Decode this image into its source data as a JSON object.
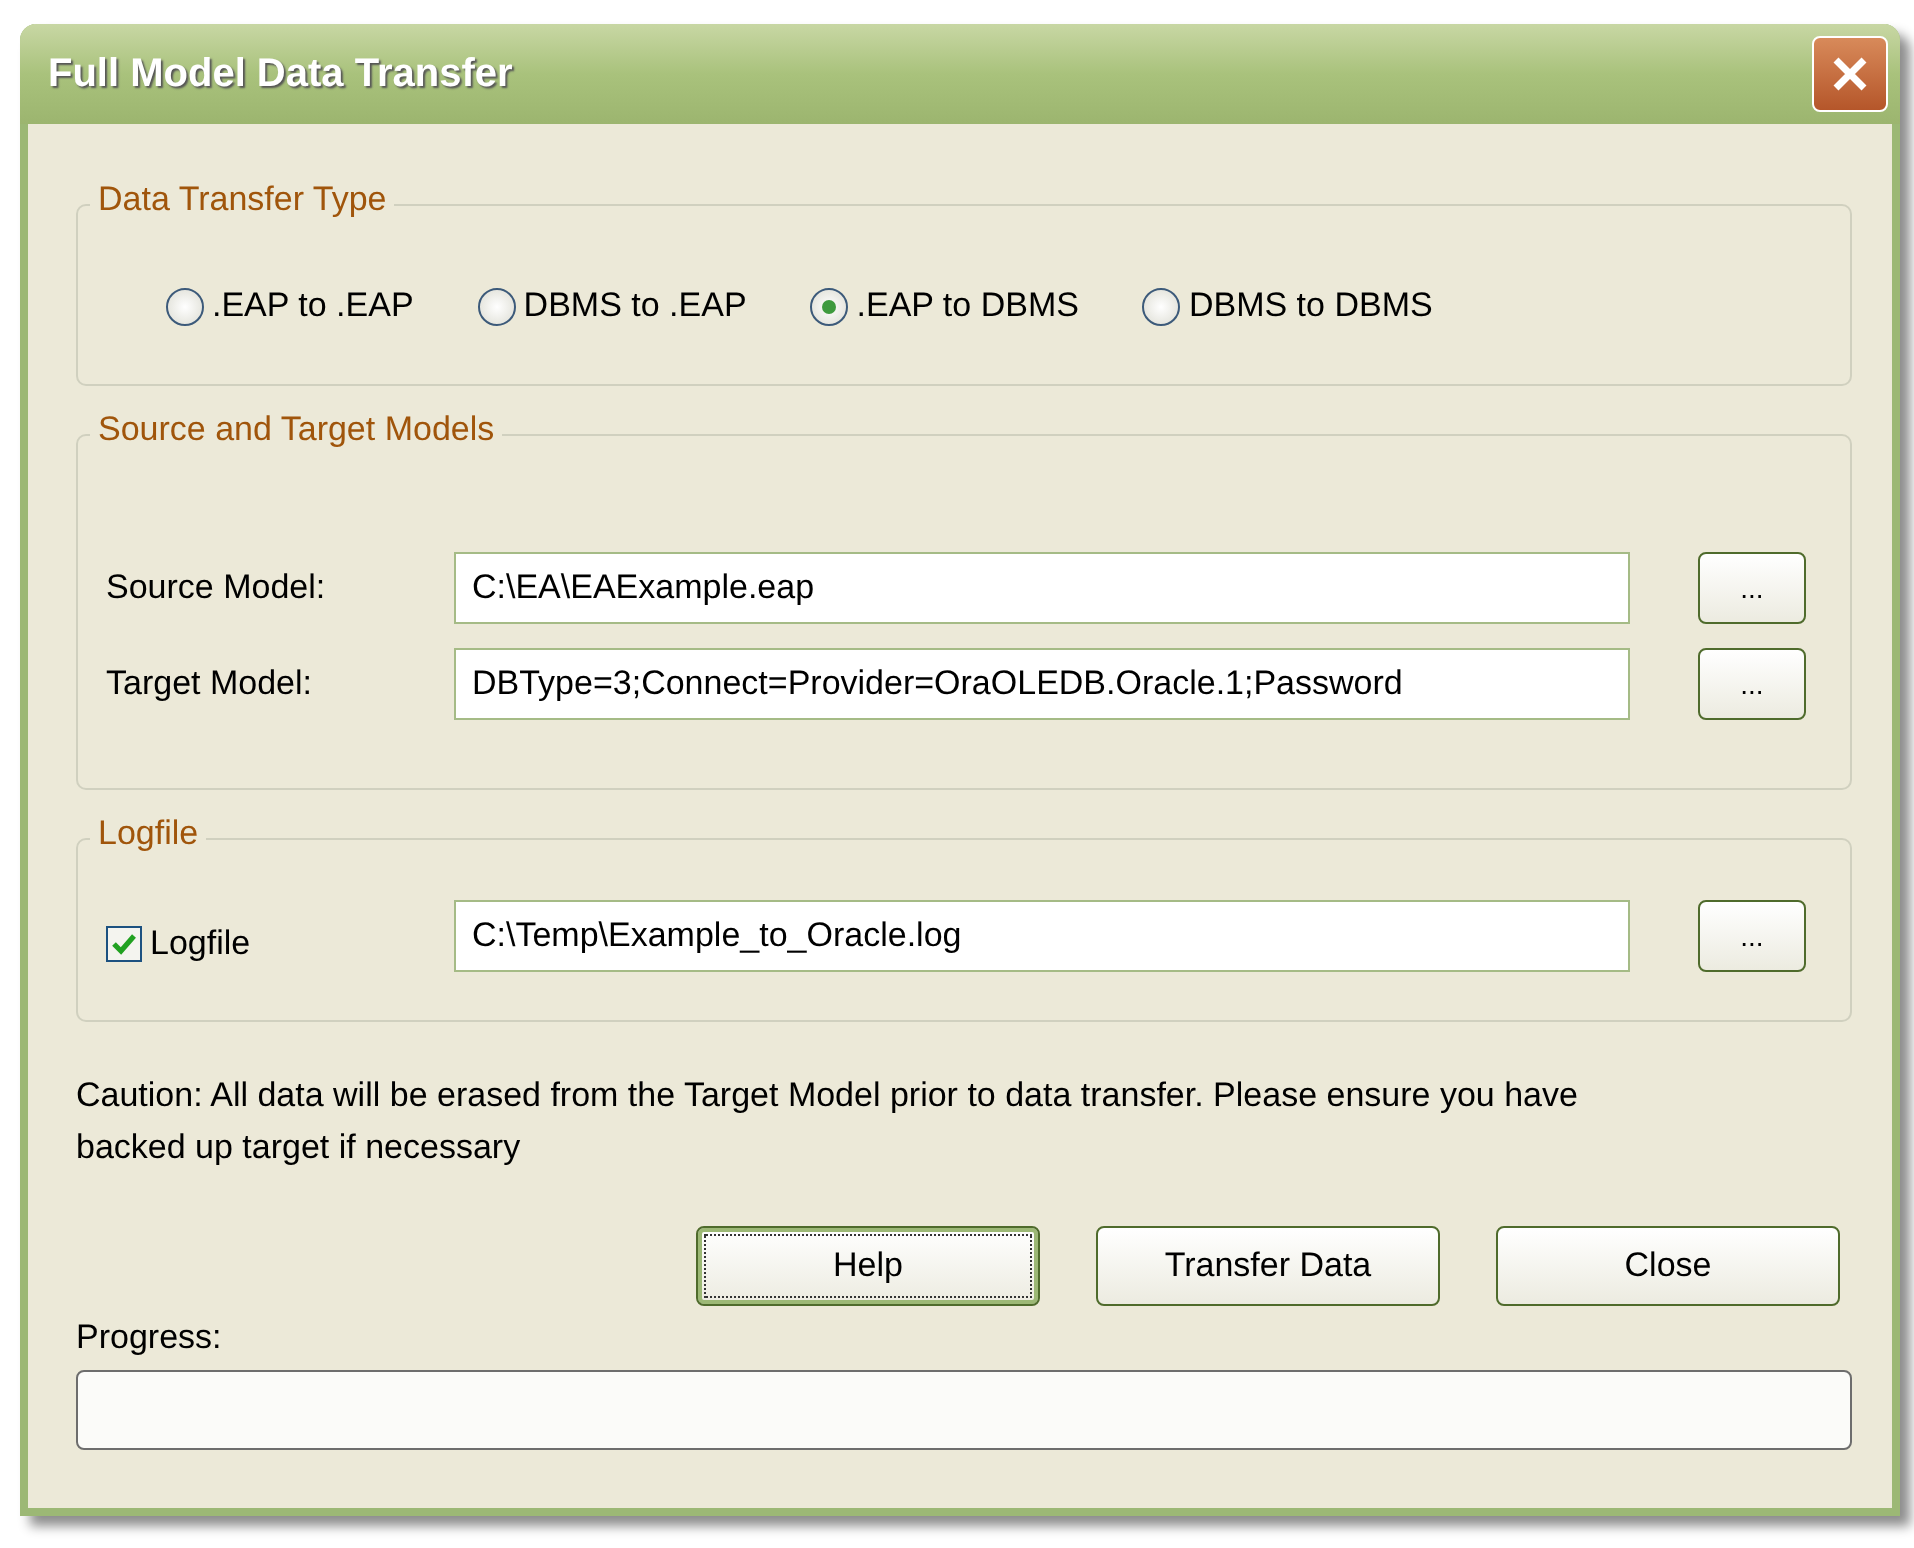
{
  "window": {
    "title": "Full Model Data Transfer"
  },
  "transfer_type": {
    "legend": "Data Transfer Type",
    "options": [
      {
        "label": ".EAP to .EAP",
        "selected": false
      },
      {
        "label": "DBMS to .EAP",
        "selected": false
      },
      {
        "label": ".EAP to DBMS",
        "selected": true
      },
      {
        "label": "DBMS to DBMS",
        "selected": false
      }
    ]
  },
  "models": {
    "legend": "Source and Target Models",
    "rows": [
      {
        "label": "Source Model:",
        "value": "C:\\EA\\EAExample.eap",
        "browse": "..."
      },
      {
        "label": "Target Model:",
        "value": "DBType=3;Connect=Provider=OraOLEDB.Oracle.1;Password",
        "browse": "..."
      }
    ]
  },
  "logfile": {
    "legend": "Logfile",
    "label": "Logfile",
    "checked": true,
    "value": "C:\\Temp\\Example_to_Oracle.log",
    "browse": "..."
  },
  "caution": "Caution: All data will be erased from the Target Model prior to data transfer. Please ensure you have backed up target if necessary",
  "buttons": [
    {
      "label": "Help",
      "focused": true
    },
    {
      "label": "Transfer Data",
      "focused": false
    },
    {
      "label": "Close",
      "focused": false
    }
  ],
  "progress": {
    "label": "Progress:",
    "level": 0
  }
}
